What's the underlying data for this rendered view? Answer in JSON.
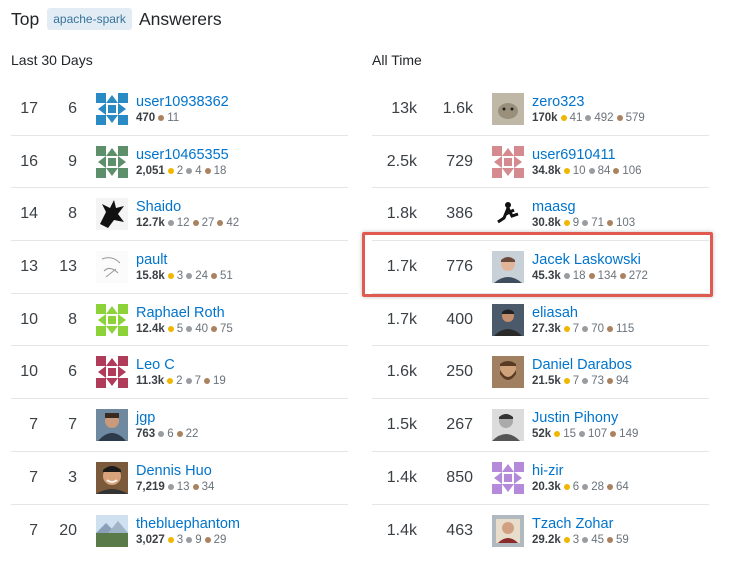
{
  "header": {
    "prefix": "Top",
    "tag": "apache-spark",
    "suffix": "Answerers"
  },
  "highlight_color": "#e05a52",
  "link_color": "#0074cc",
  "last30": {
    "title": "Last 30 Days",
    "rows": [
      {
        "score": "17",
        "answers": "6",
        "name": "user10938362",
        "rep": "470",
        "gold": "",
        "silver": "",
        "bronze": "11",
        "avatar": "identicon-blue"
      },
      {
        "score": "16",
        "answers": "9",
        "name": "user10465355",
        "rep": "2,051",
        "gold": "2",
        "silver": "4",
        "bronze": "18",
        "avatar": "identicon-green"
      },
      {
        "score": "14",
        "answers": "8",
        "name": "Shaido",
        "rep": "12.7k",
        "gold": "",
        "silver": "12",
        "bronze": "27",
        "bronze2": "42",
        "avatar": "sonic-silhouette"
      },
      {
        "score": "13",
        "answers": "13",
        "name": "pault",
        "rep": "15.8k",
        "gold": "3",
        "silver": "24",
        "bronze": "51",
        "avatar": "sketch-drawing"
      },
      {
        "score": "10",
        "answers": "8",
        "name": "Raphael Roth",
        "rep": "12.4k",
        "gold": "5",
        "silver": "40",
        "bronze": "75",
        "avatar": "identicon-lime"
      },
      {
        "score": "10",
        "answers": "6",
        "name": "Leo C",
        "rep": "11.3k",
        "gold": "2",
        "silver": "7",
        "bronze": "19",
        "avatar": "identicon-red"
      },
      {
        "score": "7",
        "answers": "7",
        "name": "jgp",
        "rep": "763",
        "gold": "",
        "silver": "6",
        "bronze": "22",
        "avatar": "photo-man-suit"
      },
      {
        "score": "7",
        "answers": "3",
        "name": "Dennis Huo",
        "rep": "7,219",
        "gold": "",
        "silver": "13",
        "bronze": "34",
        "avatar": "photo-man-smile"
      },
      {
        "score": "7",
        "answers": "20",
        "name": "thebluephantom",
        "rep": "3,027",
        "gold": "3",
        "silver": "9",
        "bronze": "29",
        "avatar": "photo-landscape"
      }
    ]
  },
  "alltime": {
    "title": "All Time",
    "rows": [
      {
        "score": "13k",
        "answers": "1.6k",
        "name": "zero323",
        "rep": "170k",
        "gold": "41",
        "silver": "492",
        "bronze": "579",
        "avatar": "photo-animal"
      },
      {
        "score": "2.5k",
        "answers": "729",
        "name": "user6910411",
        "rep": "34.8k",
        "gold": "10",
        "silver": "84",
        "bronze": "106",
        "avatar": "identicon-pink"
      },
      {
        "score": "1.8k",
        "answers": "386",
        "name": "maasg",
        "rep": "30.8k",
        "gold": "9",
        "silver": "71",
        "bronze": "103",
        "avatar": "photo-jumper"
      },
      {
        "score": "1.7k",
        "answers": "776",
        "name": "Jacek Laskowski",
        "rep": "45.3k",
        "gold": "",
        "silver": "18",
        "bronze": "134",
        "bronze2": "272",
        "avatar": "photo-portrait"
      },
      {
        "score": "1.7k",
        "answers": "400",
        "name": "eliasah",
        "rep": "27.3k",
        "gold": "7",
        "silver": "70",
        "bronze": "115",
        "avatar": "photo-man-dark"
      },
      {
        "score": "1.6k",
        "answers": "250",
        "name": "Daniel Darabos",
        "rep": "21.5k",
        "gold": "7",
        "silver": "73",
        "bronze": "94",
        "avatar": "photo-man-beard"
      },
      {
        "score": "1.5k",
        "answers": "267",
        "name": "Justin Pihony",
        "rep": "52k",
        "gold": "15",
        "silver": "107",
        "bronze": "149",
        "avatar": "photo-man-bw"
      },
      {
        "score": "1.4k",
        "answers": "850",
        "name": "hi-zir",
        "rep": "20.3k",
        "gold": "6",
        "silver": "28",
        "bronze": "64",
        "avatar": "identicon-purple"
      },
      {
        "score": "1.4k",
        "answers": "463",
        "name": "Tzach Zohar",
        "rep": "29.2k",
        "gold": "3",
        "silver": "45",
        "bronze": "59",
        "avatar": "photo-man-frame"
      }
    ]
  }
}
